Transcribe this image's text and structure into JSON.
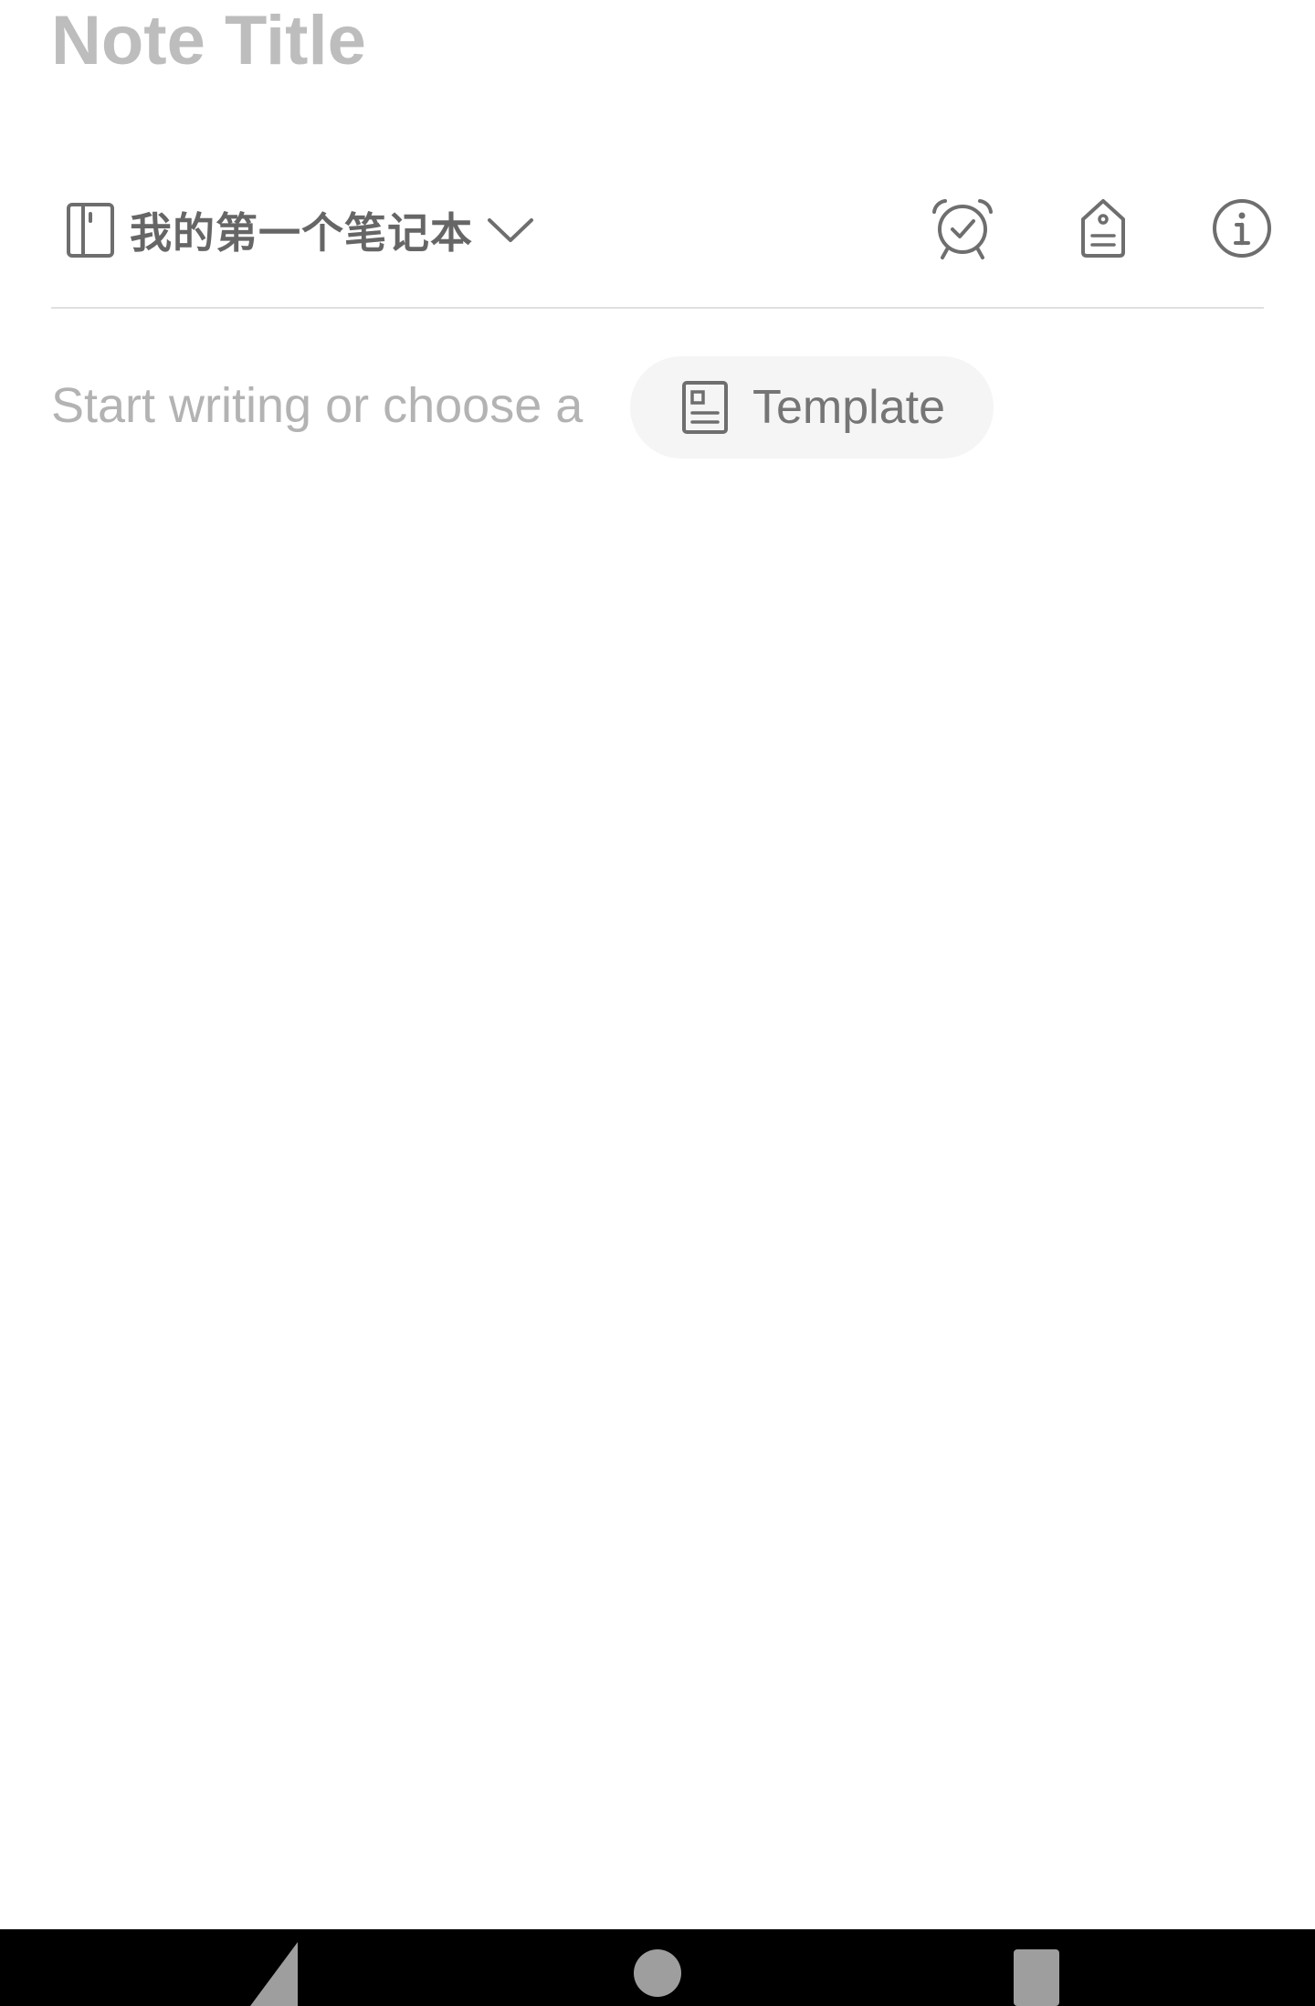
{
  "note": {
    "title_placeholder": "Note Title",
    "title_value": ""
  },
  "notebook": {
    "name": "我的第一个笔记本",
    "icon": "notebook-icon",
    "dropdown_icon": "chevron-down-icon"
  },
  "toolbar": {
    "reminder_icon": "alarm-clock-check-icon",
    "tag_icon": "tag-icon",
    "info_icon": "info-icon"
  },
  "editor": {
    "placeholder": "Start writing or choose a",
    "template_label": "Template",
    "template_icon": "template-icon"
  },
  "system_nav": {
    "back_icon": "back-triangle-icon",
    "home_icon": "home-circle-icon",
    "recents_icon": "recents-square-icon"
  },
  "colors": {
    "background": "#ffffff",
    "title_placeholder": "#bdbdbd",
    "icon": "#6e6e6e",
    "notebook_text": "#666666",
    "divider": "#e0e0e0",
    "editor_placeholder": "#b3b3b3",
    "chip_background": "#f5f5f5",
    "nav_bar": "#000000",
    "nav_icons": "#9e9e9e"
  }
}
